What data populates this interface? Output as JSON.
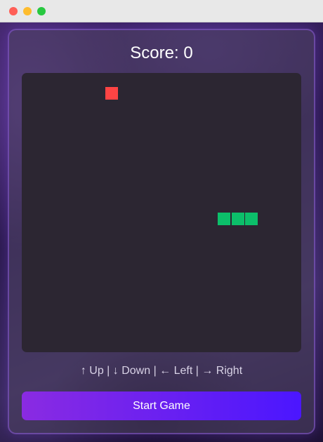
{
  "window": {
    "controls": [
      {
        "name": "close",
        "color": "#ff5f57"
      },
      {
        "name": "minimize",
        "color": "#febc2e"
      },
      {
        "name": "zoom",
        "color": "#28c840"
      }
    ]
  },
  "game": {
    "score_text": "Score: 0",
    "controls_text": "↑ Up | ↓ Down | ← Left | → Right",
    "start_label": "Start Game",
    "colors": {
      "food": "#ff4444",
      "snake": "#0cbf6a",
      "board": "#2c2632",
      "button_start": "#8a2be2",
      "button_end": "#4b16ff"
    },
    "grid_size": 20,
    "food": {
      "col": 6,
      "row": 1
    },
    "snake": [
      {
        "col": 14,
        "row": 10
      },
      {
        "col": 15,
        "row": 10
      },
      {
        "col": 16,
        "row": 10
      }
    ]
  }
}
